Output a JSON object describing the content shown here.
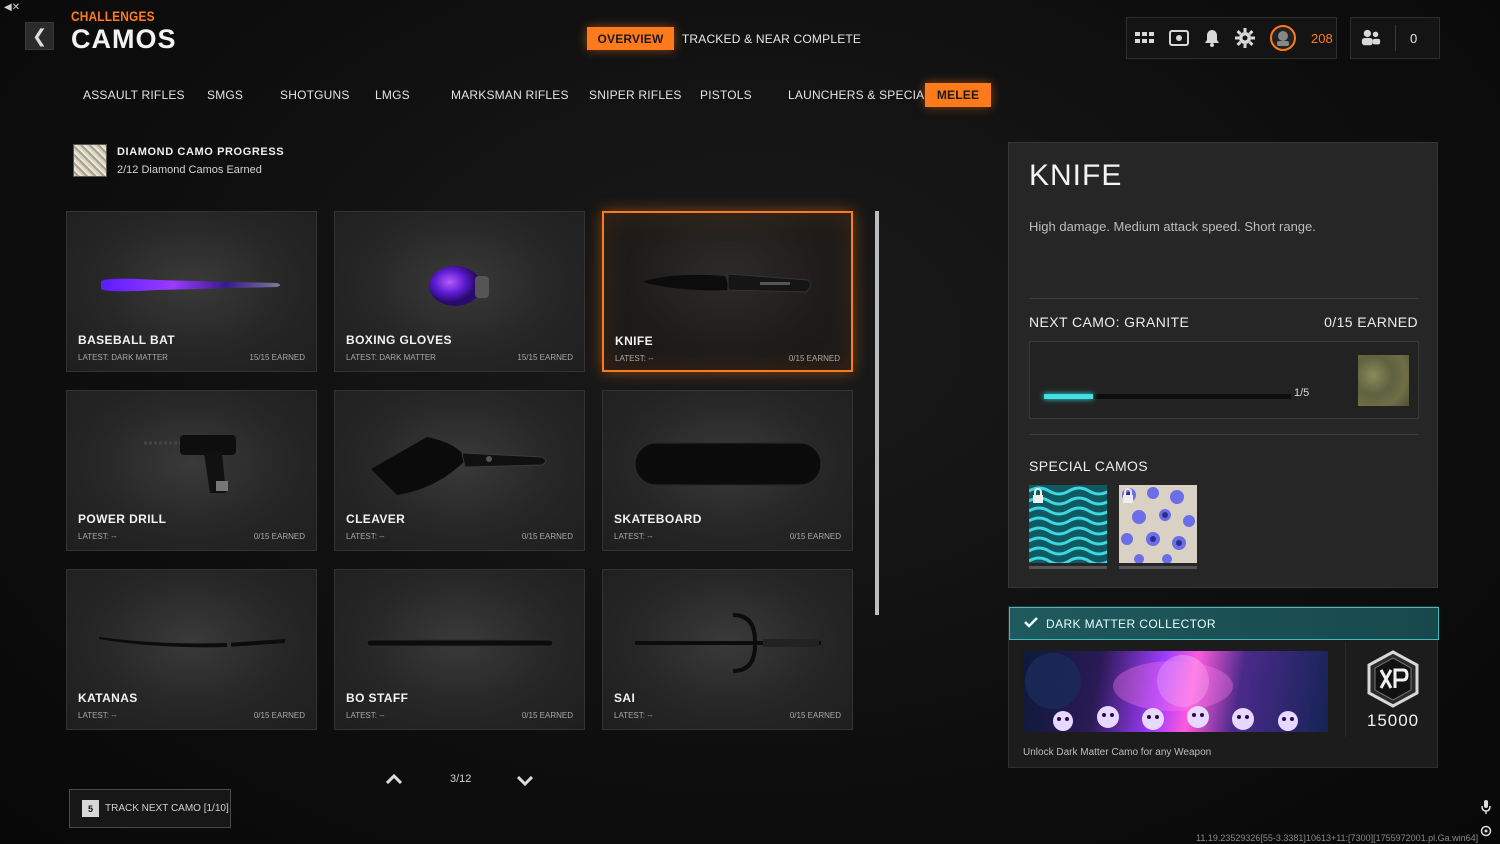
{
  "header": {
    "top_left_mark": "◀✕",
    "back_label": "❮",
    "section_small": "CHALLENGES",
    "section_big": "CAMOS",
    "tabs": [
      {
        "label": "OVERVIEW",
        "active": true
      },
      {
        "label": "TRACKED & NEAR COMPLETE",
        "active": false
      }
    ],
    "hud": {
      "currency_value": "208",
      "party_count": "0"
    }
  },
  "categories": [
    {
      "label": "ASSAULT RIFLES"
    },
    {
      "label": "SMGS"
    },
    {
      "label": "SHOTGUNS"
    },
    {
      "label": "LMGS"
    },
    {
      "label": "MARKSMAN RIFLES"
    },
    {
      "label": "SNIPER RIFLES"
    },
    {
      "label": "PISTOLS"
    },
    {
      "label": "LAUNCHERS & SPECIALS"
    },
    {
      "label": "MELEE",
      "active": true
    }
  ],
  "diamond_progress": {
    "title": "DIAMOND CAMO PROGRESS",
    "subtitle": "2/12 Diamond Camos Earned"
  },
  "weapons": [
    {
      "name": "BASEBALL BAT",
      "latest": "LATEST: DARK MATTER",
      "earned": "15/15 EARNED"
    },
    {
      "name": "BOXING GLOVES",
      "latest": "LATEST: DARK MATTER",
      "earned": "15/15 EARNED"
    },
    {
      "name": "KNIFE",
      "latest": "LATEST: --",
      "earned": "0/15 EARNED",
      "selected": true
    },
    {
      "name": "POWER DRILL",
      "latest": "LATEST: --",
      "earned": "0/15 EARNED"
    },
    {
      "name": "CLEAVER",
      "latest": "LATEST: --",
      "earned": "0/15 EARNED"
    },
    {
      "name": "SKATEBOARD",
      "latest": "LATEST: --",
      "earned": "0/15 EARNED"
    },
    {
      "name": "KATANAS",
      "latest": "LATEST: --",
      "earned": "0/15 EARNED"
    },
    {
      "name": "BO STAFF",
      "latest": "LATEST: --",
      "earned": "0/15 EARNED"
    },
    {
      "name": "SAI",
      "latest": "LATEST: --",
      "earned": "0/15 EARNED"
    }
  ],
  "pager": {
    "text": "3/12"
  },
  "track_button": {
    "key": "5",
    "label": "TRACK NEXT CAMO [1/10]"
  },
  "detail": {
    "title": "KNIFE",
    "description": "High damage. Medium attack speed. Short range.",
    "next_camo": "NEXT CAMO: GRANITE",
    "earned": "0/15 EARNED",
    "challenge_progress": 0.2,
    "challenge_count": "1/5",
    "special_camos_title": "SPECIAL CAMOS"
  },
  "collector": {
    "title": "DARK MATTER COLLECTOR",
    "xp_value": "15000",
    "description": "Unlock Dark Matter Camo for any Weapon"
  },
  "build_info": "11.19.23529326[55-3.3381]10613+11:[7300][1755972001.pl.Ga.win64]",
  "colors": {
    "accent": "#ff7a1a",
    "teal": "#3fe0e6"
  }
}
